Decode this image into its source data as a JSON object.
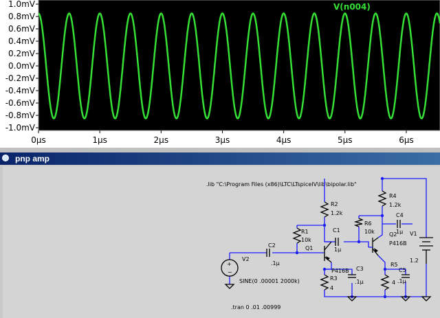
{
  "plot": {
    "trace_label": "V(n004)",
    "trace_color": "#35e035",
    "background": "#000000",
    "y_ticks": [
      "1.0mV",
      "0.8mV",
      "0.6mV",
      "0.4mV",
      "0.2mV",
      "0.0mV",
      "-0.2mV",
      "-0.4mV",
      "-0.6mV",
      "-0.8mV",
      "-1.0mV"
    ],
    "x_ticks": [
      "0µs",
      "1µs",
      "2µs",
      "3µs",
      "4µs",
      "5µs",
      "6µs"
    ]
  },
  "chart_data": {
    "type": "line",
    "title": "V(n004)",
    "xlabel": "",
    "ylabel": "",
    "x_unit": "µs",
    "y_unit": "mV",
    "xlim": [
      0,
      6.55
    ],
    "ylim": [
      -1.0,
      1.0
    ],
    "grid": false,
    "series": [
      {
        "name": "V(n004)",
        "waveform": "sine",
        "frequency_per_us": 2.0,
        "amplitude": 0.85,
        "offset": 0.0
      }
    ]
  },
  "schematic": {
    "window_title": "pnp amp",
    "lib_directive": ".lib \"C:\\Program Files (x86)\\LTC\\LTspiceIV\\lib\\bipolar.lib\"",
    "tran_directive": ".tran 0 .01 .00999",
    "source_value": "SINE(0 .00001 2000k)",
    "components": {
      "R1": "R1",
      "R1_val": "10k",
      "R2": "R2",
      "R2_val": "1.2k",
      "R3": "R3",
      "R3_val": "4",
      "R4": "R4",
      "R4_val": "1.2k",
      "R5": "R5",
      "R5_val": "4",
      "R6": "R6",
      "R6_val": "10k",
      "C1": "C1",
      "C1_val": "1µ",
      "C2": "C2",
      "C2_val": ".1µ",
      "C3": "C3",
      "C3_val": ".1µ",
      "C4": "C4",
      "C4_val": "1µ",
      "C5": "C5",
      "C5_val": ".1µ",
      "Q1": "Q1",
      "Q1_val": "P416B",
      "Q2": "Q2",
      "Q2_val": "P416B",
      "V1": "V1",
      "V1_val": "1.2",
      "V2": "V2"
    }
  }
}
